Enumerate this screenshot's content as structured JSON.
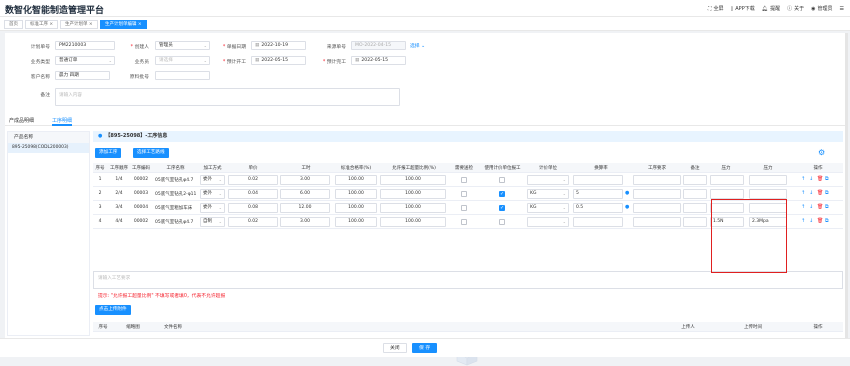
{
  "app": {
    "title": "数智化智能制造管理平台"
  },
  "toolbar": {
    "fullscreen": "全屏",
    "app_download": "APP下载",
    "reminder": "提醒",
    "about": "关于",
    "user": "管理员"
  },
  "nav_tabs": [
    {
      "label": "首页"
    },
    {
      "label": "标准工序 ×"
    },
    {
      "label": "生产计划单 ×"
    },
    {
      "label": "生产计划单编辑 ×"
    }
  ],
  "form": {
    "plan_no": {
      "label": "计划单号",
      "value": "PM2210003"
    },
    "creator": {
      "label": "创建人",
      "value": "管理员"
    },
    "doc_date": {
      "label": "单据日期",
      "value": "2022-10-19"
    },
    "source_no": {
      "label": "来源单号",
      "value": "MO-2022-04-15",
      "link": "选择"
    },
    "biz_type": {
      "label": "业务类型",
      "value": "普通订单"
    },
    "salesman": {
      "label": "业务员",
      "placeholder": "请选择"
    },
    "plan_start": {
      "label": "预计开工",
      "value": "2022-05-15"
    },
    "plan_end": {
      "label": "预计完工",
      "value": "2022-05-15"
    },
    "customer": {
      "label": "客户名称",
      "value": "晨力 四期"
    },
    "batch": {
      "label": "原料批号",
      "value": ""
    },
    "note": {
      "label": "备注",
      "placeholder": "请输入内容"
    }
  },
  "sub_tabs": [
    {
      "label": "产成品明细"
    },
    {
      "label": "工序明细"
    }
  ],
  "left": {
    "header": "产品名称",
    "item": "895-25098(CODL200003)"
  },
  "info": {
    "title": "【895-25098】-工序信息"
  },
  "buttons": {
    "add_process": "添加工序",
    "select_route": "选择工艺路线",
    "upload": "点击上传附件",
    "close": "关闭",
    "save": "保 存"
  },
  "process_table": {
    "columns": [
      "序号",
      "工序顺序",
      "工序编码",
      "工序名称",
      "加工方式",
      "单价",
      "工时",
      "标准合格率(%)",
      "允许报工超量比例(%)",
      "需要送检",
      "使用计价单位报工",
      "计价单位",
      "换算率",
      "工序要求",
      "备注",
      "压力",
      "压力",
      "操作"
    ],
    "rows": [
      {
        "no": "1",
        "order": "1/4",
        "code": "00002",
        "name": "05底气室钻孔φ4.7",
        "mode": "委外",
        "price": "0.02",
        "hours": "3.00",
        "rate": "100.00",
        "over": "100.00",
        "inspect": false,
        "use_unit": false,
        "unit": "",
        "conv": "",
        "p1": "",
        "p2": ""
      },
      {
        "no": "2",
        "order": "2/4",
        "code": "00003",
        "name": "05底气室钻孔2-φ11",
        "mode": "委外",
        "price": "0.04",
        "hours": "6.00",
        "rate": "100.00",
        "over": "100.00",
        "inspect": false,
        "use_unit": true,
        "unit": "KG",
        "conv": "5",
        "p1": "",
        "p2": ""
      },
      {
        "no": "3",
        "order": "3/4",
        "code": "00004",
        "name": "05底气室粗加车床",
        "mode": "委外",
        "price": "0.08",
        "hours": "12.00",
        "rate": "100.00",
        "over": "100.00",
        "inspect": false,
        "use_unit": true,
        "unit": "KG",
        "conv": "0.5",
        "p1": "",
        "p2": ""
      },
      {
        "no": "4",
        "order": "4/4",
        "code": "00002",
        "name": "05底气室钻孔φ4.7",
        "mode": "自制",
        "price": "0.02",
        "hours": "3.00",
        "rate": "100.00",
        "over": "100.00",
        "inspect": false,
        "use_unit": false,
        "unit": "",
        "conv": "",
        "p1": "1.5N",
        "p2": "2.3Mpa"
      }
    ]
  },
  "remark": {
    "placeholder": "请输入工艺要求"
  },
  "tip": "提示: \"允许报工超量比例\" 不填写或者填0，代表不允许超报",
  "file_table": {
    "columns": [
      "序号",
      "缩略图",
      "文件名称",
      "上传人",
      "上传时间",
      "操作"
    ]
  },
  "colors": {
    "primary": "#1890ff",
    "danger": "#f5222d",
    "highlight": "#e02020"
  }
}
